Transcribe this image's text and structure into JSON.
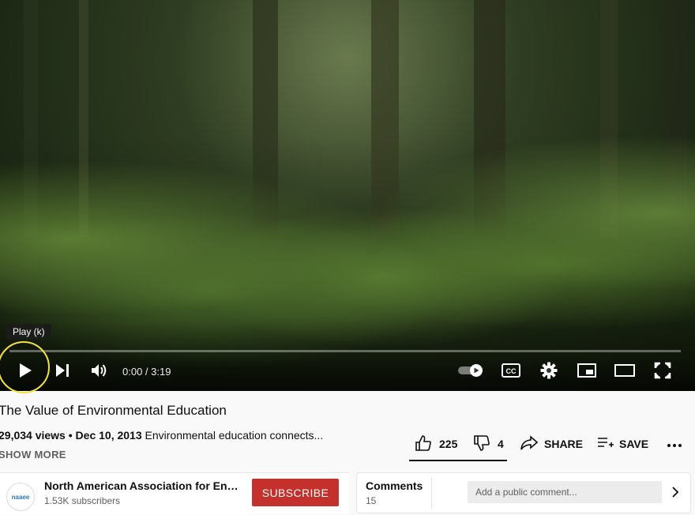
{
  "player": {
    "tooltip": "Play (k)",
    "time": "0:00 / 3:19",
    "progress": 0,
    "icons": {
      "play": "play-icon",
      "next": "next-icon",
      "volume": "volume-icon",
      "autoplay": "autoplay-toggle-icon",
      "captions": "captions-icon",
      "settings": "gear-icon",
      "miniplayer": "miniplayer-icon",
      "theater": "theater-icon",
      "fullscreen": "fullscreen-icon"
    }
  },
  "video": {
    "title": "The Value of Environmental Education",
    "views": "29,034 views",
    "separator": " • ",
    "date": "Dec 10, 2013",
    "description_snippet": "Environmental education connects...",
    "show_more": "SHOW MORE"
  },
  "actions": {
    "likes": "225",
    "dislikes": "4",
    "share": "SHARE",
    "save": "SAVE",
    "more_icon": "more-icon"
  },
  "channel": {
    "name": "North American Association for Envi...",
    "subscribers": "1.53K subscribers",
    "subscribe": "SUBSCRIBE",
    "avatar_text": "naaee"
  },
  "comments": {
    "label": "Comments",
    "count": "15",
    "placeholder": "Add a public comment..."
  },
  "colors": {
    "subscribe_bg": "#c4302b",
    "highlight_ring": "#f2e23d"
  }
}
